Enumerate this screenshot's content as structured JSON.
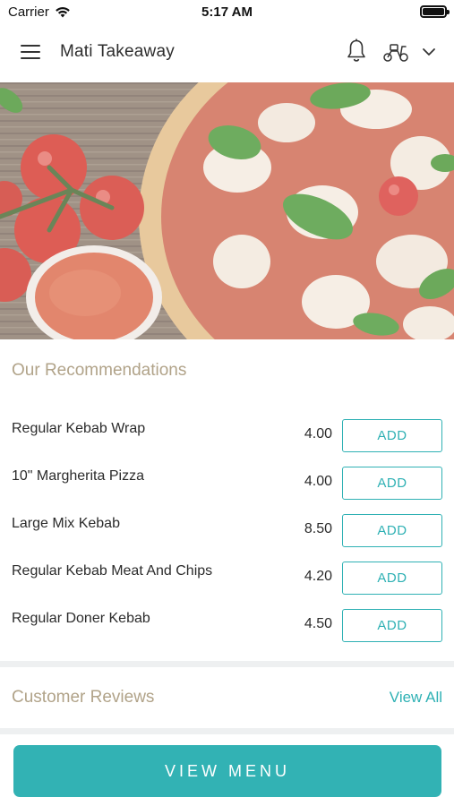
{
  "status_bar": {
    "carrier": "Carrier",
    "time": "5:17 AM"
  },
  "header": {
    "title": "Mati Takeaway",
    "icons": [
      "menu-icon",
      "bell-icon",
      "scooter-icon",
      "chevron-down-icon"
    ]
  },
  "hero": {
    "image": "pizza-margherita-with-tomatoes"
  },
  "recommendations": {
    "title": "Our Recommendations",
    "items": [
      {
        "name": "Regular Kebab Wrap",
        "price": "4.00",
        "button": "ADD"
      },
      {
        "name": "10\" Margherita Pizza",
        "price": "4.00",
        "button": "ADD"
      },
      {
        "name": "Large Mix Kebab",
        "price": "8.50",
        "button": "ADD"
      },
      {
        "name": "Regular Kebab Meat And Chips",
        "price": "4.20",
        "button": "ADD"
      },
      {
        "name": "Regular Doner Kebab",
        "price": "4.50",
        "button": "ADD"
      }
    ]
  },
  "reviews": {
    "title": "Customer Reviews",
    "view_all": "View All"
  },
  "footer": {
    "button": "VIEW MENU"
  },
  "colors": {
    "accent": "#2fb1b4",
    "section_title": "#b1a389",
    "divider": "#eef0f1"
  }
}
